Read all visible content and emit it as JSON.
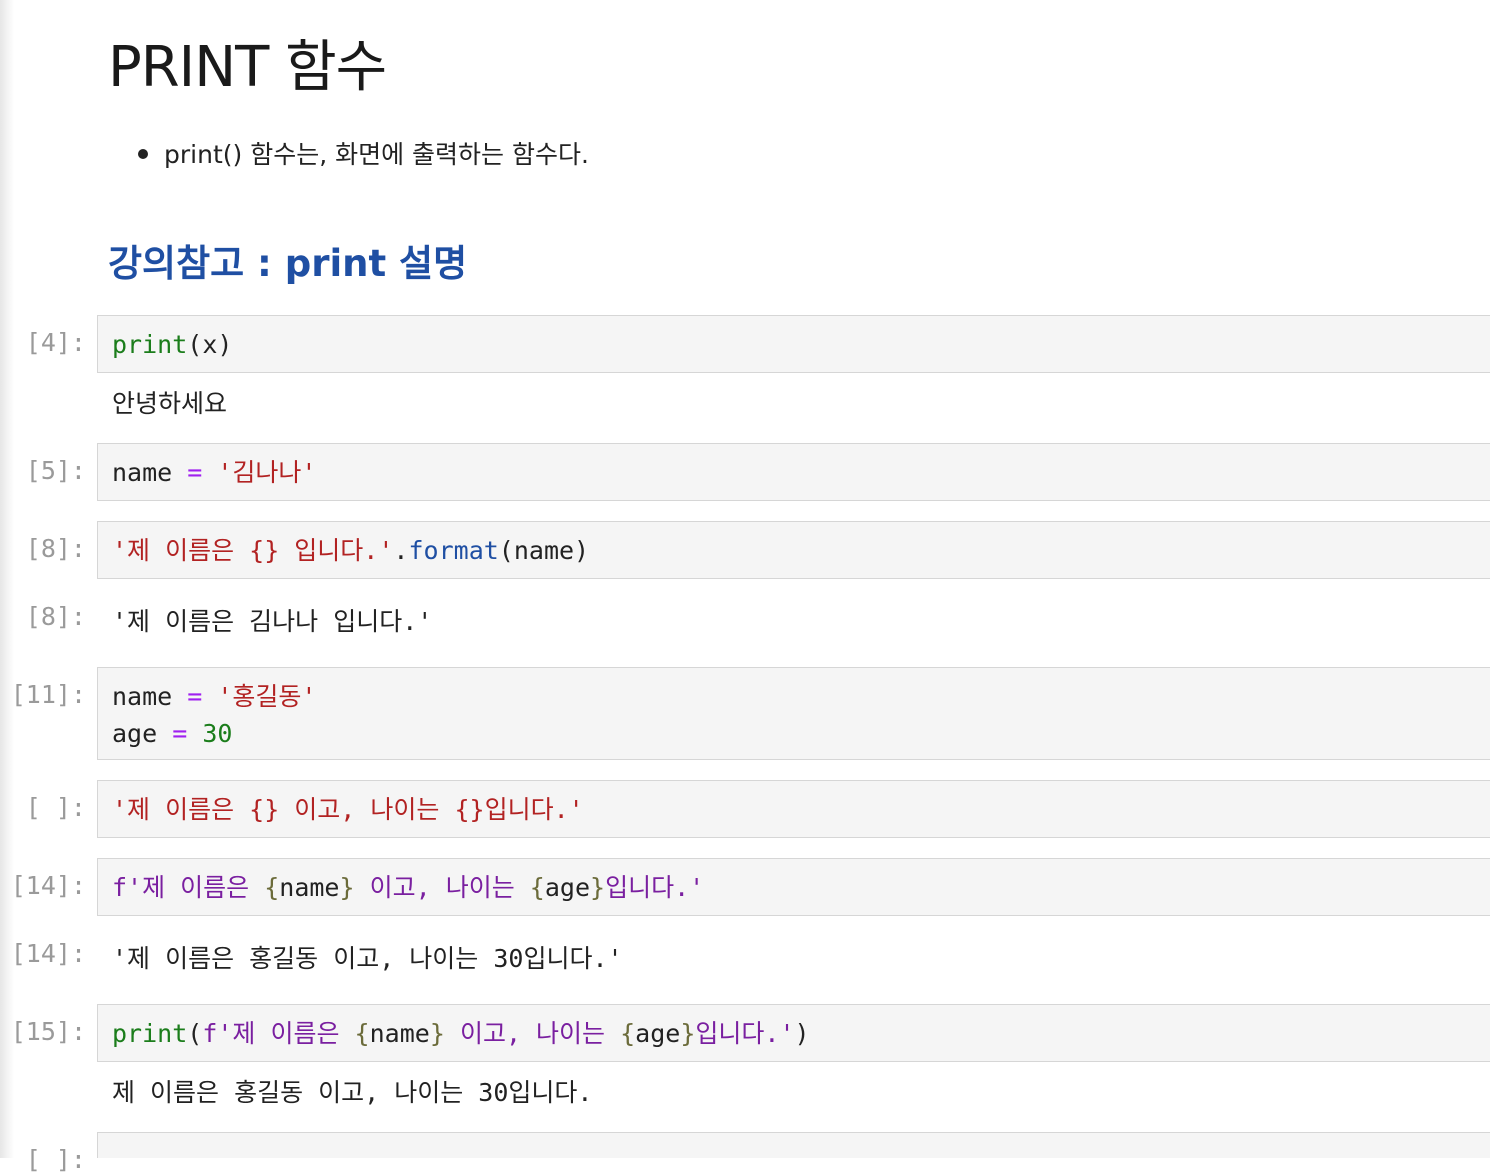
{
  "markdown": {
    "title": "PRINT 함수",
    "bullet": "print() 함수는, 화면에 출력하는 함수다.",
    "subtitle": "강의참고 : print 설명"
  },
  "cells": {
    "c1": {
      "prompt": "[4]:",
      "code": {
        "fn": "print",
        "rest": "(x)"
      },
      "output": "안녕하세요"
    },
    "c2": {
      "prompt": "[5]:",
      "code": {
        "var": "name ",
        "op": "=",
        "str": " '김나나'"
      }
    },
    "c3": {
      "prompt": "[8]:",
      "code": {
        "str": "'제 이름은 {} 입니다.'",
        "dot": ".",
        "method": "format",
        "rest": "(name)"
      },
      "out_prompt": "[8]:",
      "output": "'제 이름은 김나나 입니다.'"
    },
    "c4": {
      "prompt": "[11]:",
      "code": {
        "line1_var": "name ",
        "line1_op": "=",
        "line1_str": " '홍길동'",
        "line2_var": "age ",
        "line2_op": "=",
        "line2_num": " 30"
      }
    },
    "c5": {
      "prompt": "[ ]:",
      "code": {
        "str": "'제 이름은 {} 이고, 나이는 {}입니다.'"
      }
    },
    "c6": {
      "prompt": "[14]:",
      "code": {
        "f1": "f'제 이름은 ",
        "b1": "{",
        "v1": "name",
        "b2": "}",
        "f2": " 이고, 나이는 ",
        "b3": "{",
        "v2": "age",
        "b4": "}",
        "f3": "입니다.'"
      },
      "out_prompt": "[14]:",
      "output": "'제 이름은 홍길동 이고, 나이는 30입니다.'"
    },
    "c7": {
      "prompt": "[15]:",
      "code": {
        "fn": "print",
        "p1": "(",
        "f1": "f'제 이름은 ",
        "b1": "{",
        "v1": "name",
        "b2": "}",
        "f2": " 이고, 나이는 ",
        "b3": "{",
        "v2": "age",
        "b4": "}",
        "f3": "입니다.'",
        "p2": ")"
      },
      "output": "제 이름은 홍길동 이고, 나이는 30입니다."
    },
    "c8": {
      "prompt": "[ ]:"
    }
  }
}
